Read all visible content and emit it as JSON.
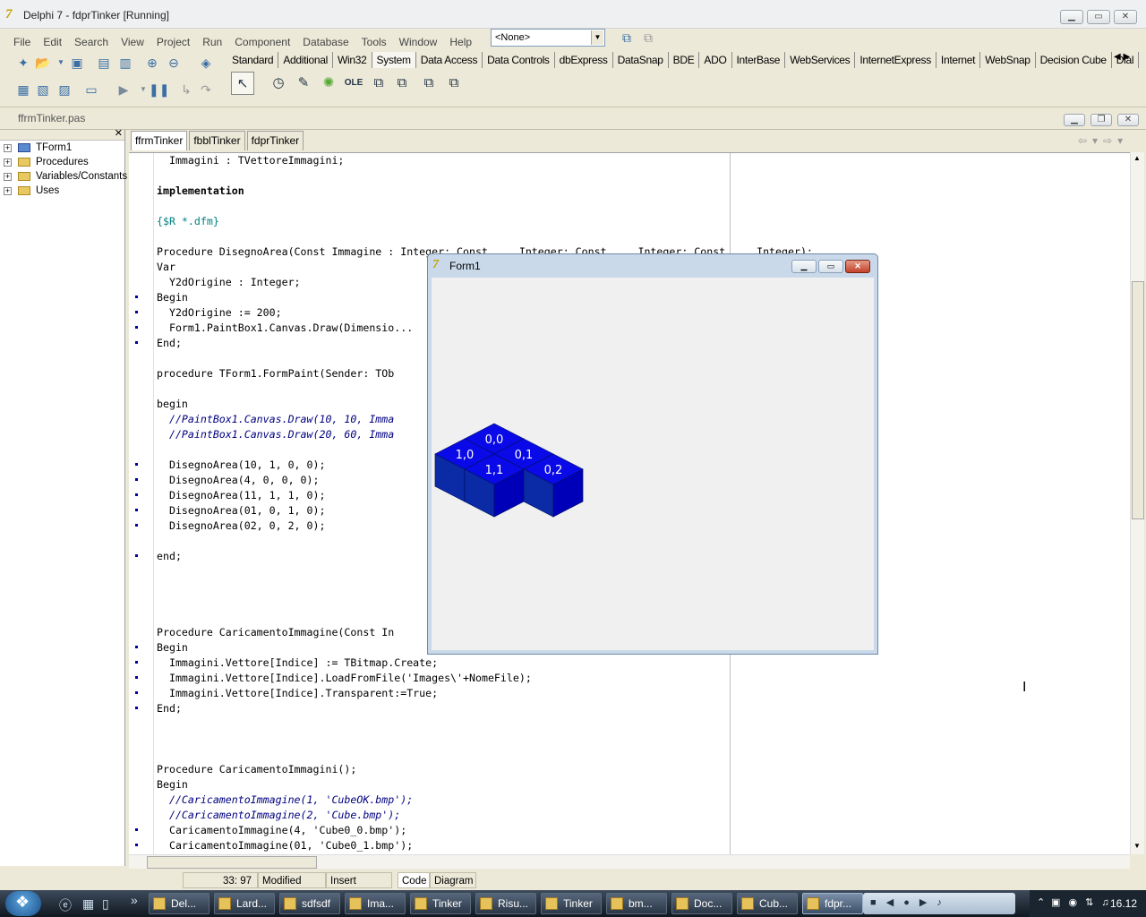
{
  "title": "Delphi 7 - fdprTinker [Running]",
  "menu": [
    "File",
    "Edit",
    "Search",
    "View",
    "Project",
    "Run",
    "Component",
    "Database",
    "Tools",
    "Window",
    "Help"
  ],
  "combo_value": "<None>",
  "palette_tabs": [
    "Standard",
    "Additional",
    "Win32",
    "System",
    "Data Access",
    "Data Controls",
    "dbExpress",
    "DataSnap",
    "BDE",
    "ADO",
    "InterBase",
    "WebServices",
    "InternetExpress",
    "Internet",
    "WebSnap",
    "Decision Cube",
    "Dial"
  ],
  "palette_selected": "System",
  "palette_ole_label": "OLE",
  "editor_title": "ffrmTinker.pas",
  "explorer": [
    "TForm1",
    "Procedures",
    "Variables/Constants",
    "Uses"
  ],
  "code_tabs": [
    "ffrmTinker",
    "fbblTinker",
    "fdprTinker"
  ],
  "code": [
    {
      "t": "  Immagini : TVettoreImmagini;",
      "d": false,
      "s": ""
    },
    {
      "t": "",
      "d": false,
      "s": ""
    },
    {
      "t": "implementation",
      "d": false,
      "s": "b"
    },
    {
      "t": "",
      "d": false,
      "s": ""
    },
    {
      "t": "{$R *.dfm}",
      "d": false,
      "s": "dir"
    },
    {
      "t": "",
      "d": false,
      "s": ""
    },
    {
      "t": "Procedure DisegnoArea(Const Immagine : Integer; Const ... Integer; Const ... Integer; Const ... Integer);",
      "d": false,
      "s": ""
    },
    {
      "t": "Var",
      "d": false,
      "s": ""
    },
    {
      "t": "  Y2dOrigine : Integer;",
      "d": false,
      "s": ""
    },
    {
      "t": "Begin",
      "d": true,
      "s": ""
    },
    {
      "t": "  Y2dOrigine := 200;",
      "d": true,
      "s": ""
    },
    {
      "t": "  Form1.PaintBox1.Canvas.Draw(Dimensio...                                      Immagini.Vettore[Immagine]);",
      "d": true,
      "s": ""
    },
    {
      "t": "End;",
      "d": true,
      "s": ""
    },
    {
      "t": "",
      "d": false,
      "s": ""
    },
    {
      "t": "procedure TForm1.FormPaint(Sender: TOb",
      "d": false,
      "s": ""
    },
    {
      "t": "",
      "d": false,
      "s": ""
    },
    {
      "t": "begin",
      "d": false,
      "s": ""
    },
    {
      "t": "  //PaintBox1.Canvas.Draw(10, 10, Imma",
      "d": false,
      "s": "cmt"
    },
    {
      "t": "  //PaintBox1.Canvas.Draw(20, 60, Imma",
      "d": false,
      "s": "cmt"
    },
    {
      "t": "",
      "d": false,
      "s": ""
    },
    {
      "t": "  DisegnoArea(10, 1, 0, 0);",
      "d": true,
      "s": ""
    },
    {
      "t": "  DisegnoArea(4, 0, 0, 0);",
      "d": true,
      "s": ""
    },
    {
      "t": "  DisegnoArea(11, 1, 1, 0);",
      "d": true,
      "s": ""
    },
    {
      "t": "  DisegnoArea(01, 0, 1, 0);",
      "d": true,
      "s": ""
    },
    {
      "t": "  DisegnoArea(02, 0, 2, 0);",
      "d": true,
      "s": ""
    },
    {
      "t": "",
      "d": false,
      "s": ""
    },
    {
      "t": "end;",
      "d": true,
      "s": ""
    },
    {
      "t": "",
      "d": false,
      "s": ""
    },
    {
      "t": "",
      "d": false,
      "s": ""
    },
    {
      "t": "",
      "d": false,
      "s": ""
    },
    {
      "t": "",
      "d": false,
      "s": ""
    },
    {
      "t": "Procedure CaricamentoImmagine(Const In",
      "d": false,
      "s": ""
    },
    {
      "t": "Begin",
      "d": true,
      "s": ""
    },
    {
      "t": "  Immagini.Vettore[Indice] := TBitmap.Create;",
      "d": true,
      "s": ""
    },
    {
      "t": "  Immagini.Vettore[Indice].LoadFromFile('Images\\'+NomeFile);",
      "d": true,
      "s": ""
    },
    {
      "t": "  Immagini.Vettore[Indice].Transparent:=True;",
      "d": true,
      "s": ""
    },
    {
      "t": "End;",
      "d": true,
      "s": ""
    },
    {
      "t": "",
      "d": false,
      "s": ""
    },
    {
      "t": "",
      "d": false,
      "s": ""
    },
    {
      "t": "",
      "d": false,
      "s": ""
    },
    {
      "t": "Procedure CaricamentoImmagini();",
      "d": false,
      "s": ""
    },
    {
      "t": "Begin",
      "d": false,
      "s": ""
    },
    {
      "t": "  //CaricamentoImmagine(1, 'CubeOK.bmp');",
      "d": false,
      "s": "cmt"
    },
    {
      "t": "  //CaricamentoImmagine(2, 'Cube.bmp');",
      "d": false,
      "s": "cmt"
    },
    {
      "t": "  CaricamentoImmagine(4, 'Cube0_0.bmp');",
      "d": true,
      "s": ""
    },
    {
      "t": "  CaricamentoImmagine(01, 'Cube0_1.bmp');",
      "d": true,
      "s": ""
    }
  ],
  "status": {
    "position": "33: 97",
    "modified": "Modified",
    "mode": "Insert",
    "tab_code": "Code",
    "tab_diagram": "Diagram"
  },
  "form1": {
    "title": "Form1",
    "labels": [
      "0,0",
      "1,0",
      "0,1",
      "1,1",
      "0,2"
    ]
  },
  "taskbar": [
    "Del...",
    "Lard...",
    "sdfsdf",
    "Ima...",
    "Tinker",
    "Risu...",
    "Tinker",
    "bm...",
    "Doc...",
    "Cub...",
    "fdpr..."
  ],
  "taskbar_active": "fdpr...",
  "clock": "16.12",
  "colors": {
    "cube_top": "#0a0ae8",
    "cube_front": "#0a2aa6",
    "cube_side": "#0000b8",
    "comment": "#000080"
  }
}
